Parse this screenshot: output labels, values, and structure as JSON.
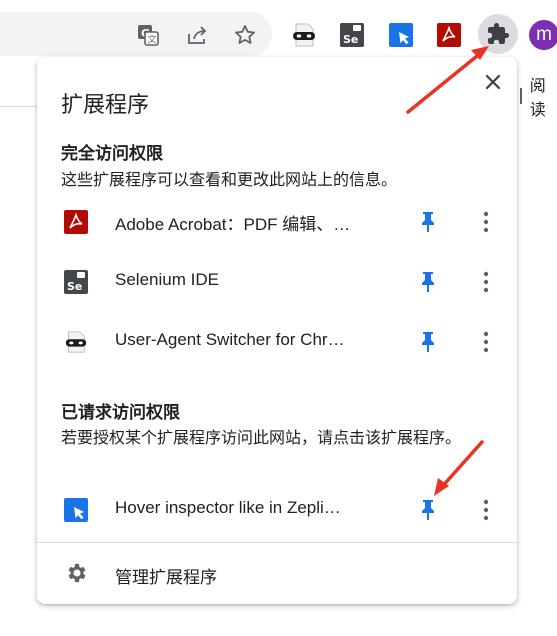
{
  "toolbar": {
    "icons": [
      "translate-icon",
      "share-icon",
      "bookmark-star-icon",
      "user-agent-switcher-icon",
      "selenium-ide-icon",
      "hover-inspector-icon",
      "adobe-acrobat-icon",
      "extensions-puzzle-icon"
    ],
    "avatar_letter": "m",
    "bookmark_text": "阅读"
  },
  "popup": {
    "title": "扩展程序",
    "full_access": {
      "title": "完全访问权限",
      "description": "这些扩展程序可以查看和更改此网站上的信息。",
      "items": [
        {
          "name": "Adobe Acrobat：PDF 编辑、…",
          "icon": "adobe-acrobat-icon",
          "pinned": true
        },
        {
          "name": "Selenium IDE",
          "icon": "selenium-ide-icon",
          "pinned": true
        },
        {
          "name": "User-Agent Switcher for Chr…",
          "icon": "user-agent-switcher-icon",
          "pinned": true
        }
      ]
    },
    "requested_access": {
      "title": "已请求访问权限",
      "description": "若要授权某个扩展程序访问此网站，请点击该扩展程序。",
      "items": [
        {
          "name": "Hover inspector like in Zepli…",
          "icon": "hover-inspector-icon",
          "pinned": true
        }
      ]
    },
    "manage_label": "管理扩展程序"
  },
  "colors": {
    "pin": "#1a73e8",
    "annotation_arrow": "#ea3323",
    "avatar": "#7b2fb5",
    "acrobat": "#b30b00",
    "hover_inspector": "#1a73e8",
    "selenium": "#43474c"
  }
}
